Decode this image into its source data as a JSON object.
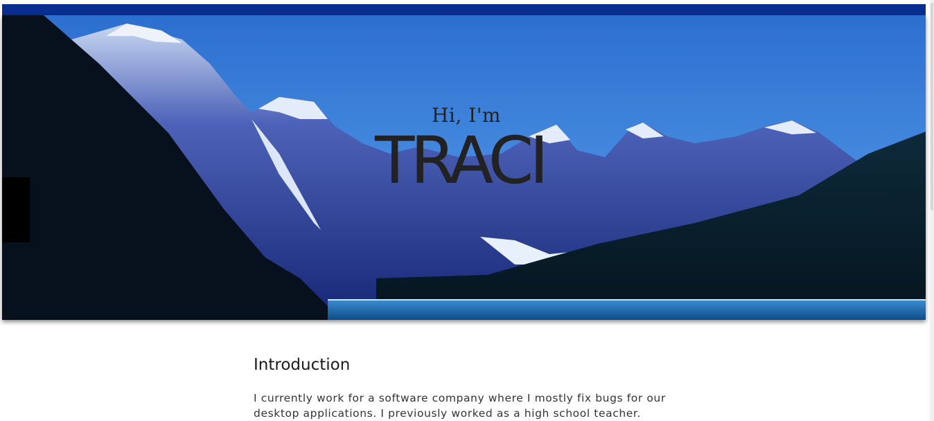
{
  "hero": {
    "greeting": "Hi, I'm",
    "name": "TRACI"
  },
  "intro": {
    "title": "Introduction",
    "body": "I currently work for a software company where I mostly fix bugs for our desktop applications. I previously worked as a high school teacher."
  },
  "colors": {
    "topbar": "#0a2e8f",
    "sky": "#2a6fd6",
    "text": "#222222"
  }
}
